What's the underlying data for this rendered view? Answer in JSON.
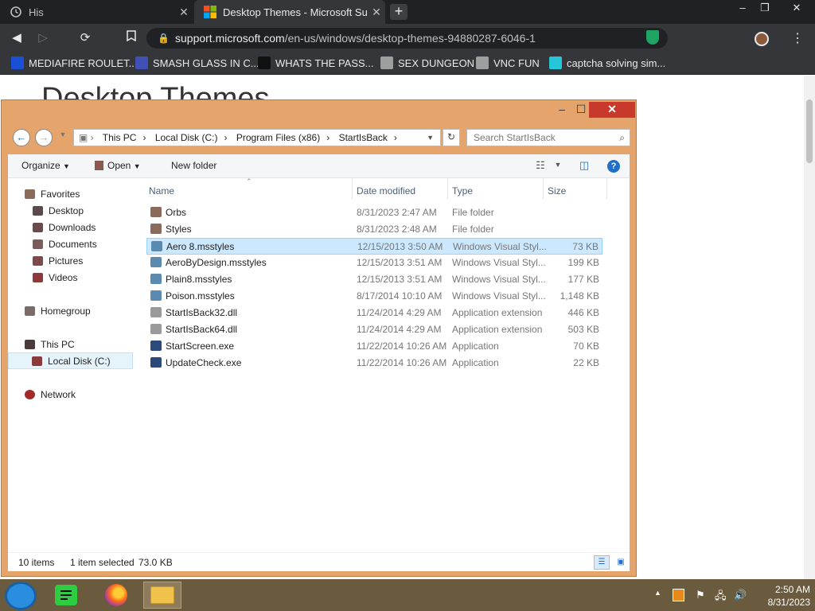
{
  "browser": {
    "tabs": [
      {
        "label": "His",
        "active": false
      },
      {
        "label": "Desktop Themes - Microsoft Supp",
        "active": true
      }
    ],
    "new_tab_label": "+",
    "window_controls": [
      "–",
      "❐",
      "✕"
    ],
    "url_domain": "support.microsoft.com",
    "url_path": "/en-us/windows/desktop-themes-94880287-6046-1",
    "bookmarks": [
      {
        "label": "MEDIAFIRE ROULET...",
        "icon_color": "#1a4fd8"
      },
      {
        "label": "SMASH GLASS IN C...",
        "icon_color": "#3f51b5"
      },
      {
        "label": "WHATS THE PASS...",
        "icon_color": "#111111"
      },
      {
        "label": "SEX DUNGEON",
        "icon_color": "#9e9e9e"
      },
      {
        "label": "VNC FUN",
        "icon_color": "#9e9e9e"
      },
      {
        "label": "captcha solving sim...",
        "icon_color": "#26c6da"
      }
    ]
  },
  "page": {
    "heading": "Desktop Themes"
  },
  "explorer": {
    "window_controls": [
      "–",
      "☐",
      "✕"
    ],
    "breadcrumb": [
      "This PC",
      "Local Disk (C:)",
      "Program Files (x86)",
      "StartIsBack"
    ],
    "search_placeholder": "Search StartIsBack",
    "toolbar": {
      "organize": "Organize",
      "open": "Open",
      "new_folder": "New folder",
      "help": "?"
    },
    "nav": {
      "favorites": "Favorites",
      "favorites_items": [
        "Desktop",
        "Downloads",
        "Documents",
        "Pictures",
        "Videos"
      ],
      "homegroup": "Homegroup",
      "this_pc": "This PC",
      "local_disk": "Local Disk (C:)",
      "network": "Network"
    },
    "columns": {
      "name": "Name",
      "date": "Date modified",
      "type": "Type",
      "size": "Size"
    },
    "files": [
      {
        "name": "Orbs",
        "date": "8/31/2023 2:47 AM",
        "type": "File folder",
        "size": "",
        "kind": "folder"
      },
      {
        "name": "Styles",
        "date": "8/31/2023 2:48 AM",
        "type": "File folder",
        "size": "",
        "kind": "folder"
      },
      {
        "name": "Aero 8.msstyles",
        "date": "12/15/2013 3:50 AM",
        "type": "Windows Visual Styl...",
        "size": "73 KB",
        "kind": "style",
        "selected": true
      },
      {
        "name": "AeroByDesign.msstyles",
        "date": "12/15/2013 3:51 AM",
        "type": "Windows Visual Styl...",
        "size": "199 KB",
        "kind": "style"
      },
      {
        "name": "Plain8.msstyles",
        "date": "12/15/2013 3:51 AM",
        "type": "Windows Visual Styl...",
        "size": "177 KB",
        "kind": "style"
      },
      {
        "name": "Poison.msstyles",
        "date": "8/17/2014 10:10 AM",
        "type": "Windows Visual Styl...",
        "size": "1,148 KB",
        "kind": "style"
      },
      {
        "name": "StartIsBack32.dll",
        "date": "11/24/2014 4:29 AM",
        "type": "Application extension",
        "size": "446 KB",
        "kind": "dll"
      },
      {
        "name": "StartIsBack64.dll",
        "date": "11/24/2014 4:29 AM",
        "type": "Application extension",
        "size": "503 KB",
        "kind": "dll"
      },
      {
        "name": "StartScreen.exe",
        "date": "11/22/2014 10:26 AM",
        "type": "Application",
        "size": "70 KB",
        "kind": "exe"
      },
      {
        "name": "UpdateCheck.exe",
        "date": "11/22/2014 10:26 AM",
        "type": "Application",
        "size": "22 KB",
        "kind": "exe"
      }
    ],
    "status": {
      "items": "10 items",
      "selected": "1 item selected",
      "selected_size": "73.0 KB"
    }
  },
  "taskbar": {
    "time": "2:50 AM",
    "date": "8/31/2023"
  },
  "colors": {
    "explorer_frame": "#e5a46b",
    "close_button": "#c8392b",
    "selection": "#cce8ff",
    "taskbar": "#6a5a3e"
  }
}
